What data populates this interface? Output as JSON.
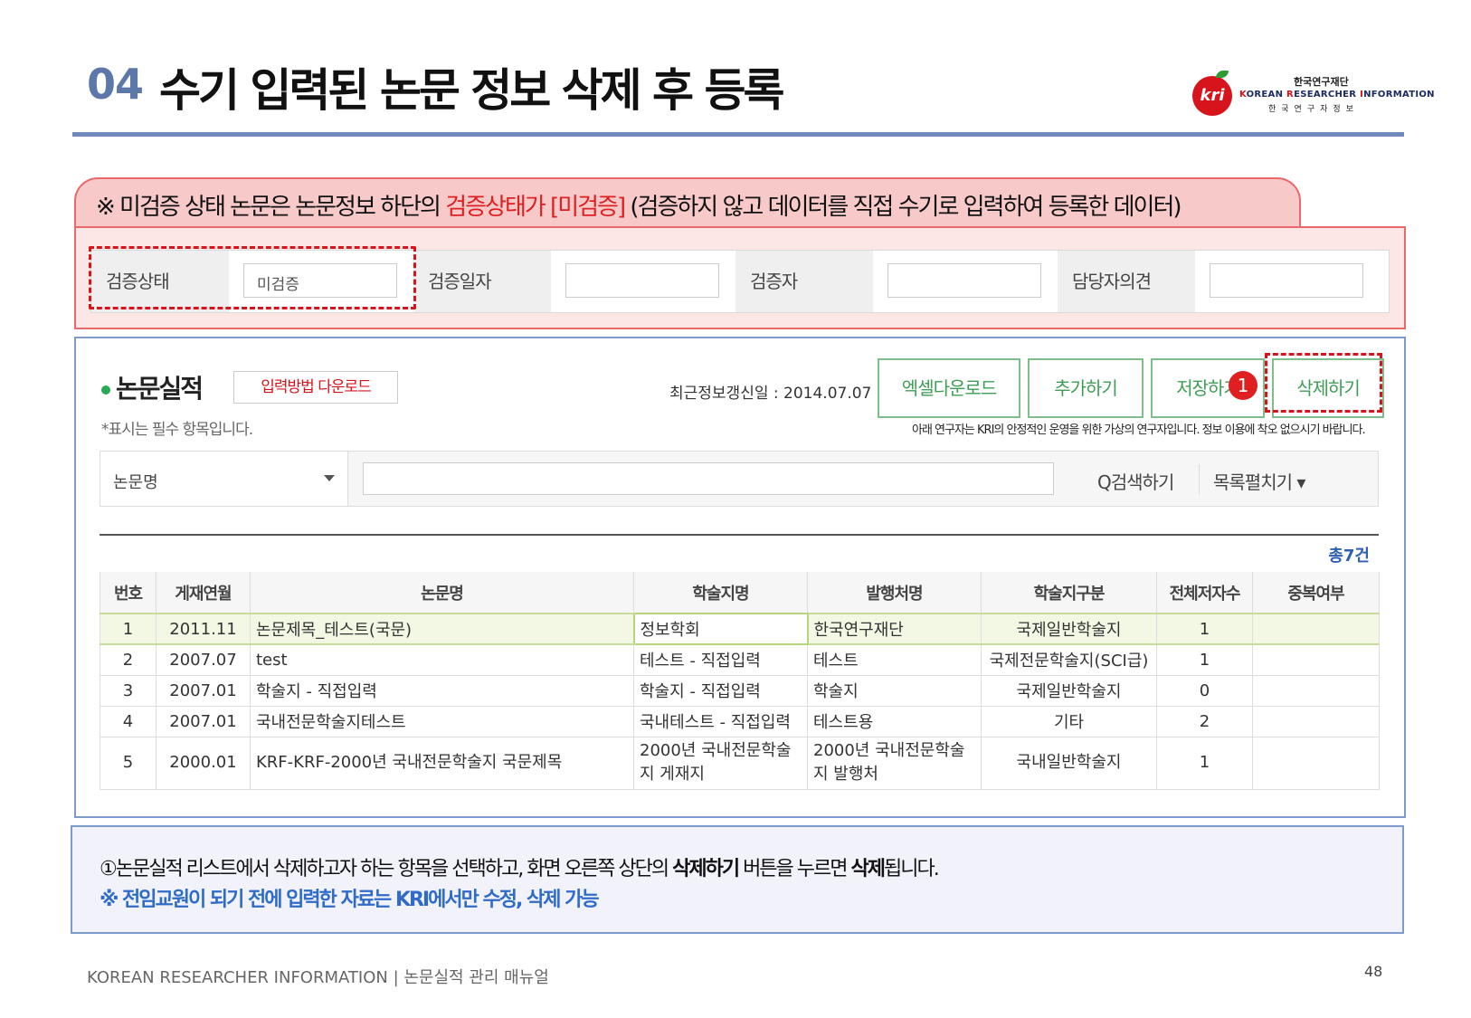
{
  "header": {
    "num": "04",
    "title": "수기 입력된 논문 정보 삭제 후 등록",
    "logo": {
      "mark": "kri",
      "kr_top": "한국연구재단",
      "en_parts": [
        "K",
        "OREAN ",
        "R",
        "ESEARCHER ",
        "I",
        "NFORMATION"
      ],
      "kr_bottom": "한국연구자정보"
    }
  },
  "notice": {
    "pre": "※ 미검증 상태 논문은 논문정보 하단의 ",
    "highlight": "검증상태가 [미검증]",
    "post": " (검증하지 않고 데이터를 직접 수기로 입력하여 등록한 데이터)"
  },
  "status_row": [
    {
      "label": "검증상태",
      "value": "미검증"
    },
    {
      "label": "검증일자",
      "value": ""
    },
    {
      "label": "검증자",
      "value": ""
    },
    {
      "label": "담당자의견",
      "value": ""
    }
  ],
  "panel": {
    "section_title": "논문실적",
    "download_label": "입력방법 다운로드",
    "required_note": "*표시는 필수 항목입니다.",
    "update_label": "최근정보갱신일 :",
    "update_date": "2014.07.07",
    "buttons": {
      "excel": "엑셀다운로드",
      "add": "추가하기",
      "save": "저장하기",
      "delete": "삭제하기"
    },
    "badge": "1",
    "virtual_note": "아래 연구자는 KRI의 안정적인 운영을 위한 가상의 연구자입니다. 정보 이용에 착오 없으시기 바랍니다.",
    "search": {
      "select_value": "논문명",
      "search_label": "Q검색하기",
      "expand_label": "목록펼치기 ▾"
    },
    "total": "총7건",
    "columns": [
      "번호",
      "게재연월",
      "논문명",
      "학술지명",
      "발행처명",
      "학술지구분",
      "전체저자수",
      "중복여부"
    ],
    "rows": [
      {
        "no": "1",
        "date": "2011.11",
        "title": "논문제목_테스트(국문)",
        "journal": "정보학회",
        "publisher": "한국연구재단",
        "type": "국제일반학술지",
        "authors": "1",
        "dup": ""
      },
      {
        "no": "2",
        "date": "2007.07",
        "title": "test",
        "journal": "테스트 - 직접입력",
        "publisher": "테스트",
        "type": "국제전문학술지(SCI급)",
        "authors": "1",
        "dup": ""
      },
      {
        "no": "3",
        "date": "2007.01",
        "title": "학술지 - 직접입력",
        "journal": "학술지 - 직접입력",
        "publisher": "학술지",
        "type": "국제일반학술지",
        "authors": "0",
        "dup": ""
      },
      {
        "no": "4",
        "date": "2007.01",
        "title": "국내전문학술지테스트",
        "journal": "국내테스트 - 직접입력",
        "publisher": "테스트용",
        "type": "기타",
        "authors": "2",
        "dup": ""
      },
      {
        "no": "5",
        "date": "2000.01",
        "title": "KRF-KRF-2000년 국내전문학술지 국문제목",
        "journal": "2000년 국내전문학술지 게재지",
        "publisher": "2000년 국내전문학술지 발행처",
        "type": "국내일반학술지",
        "authors": "1",
        "dup": ""
      }
    ]
  },
  "explanation": {
    "line1_pre": "①논문실적 리스트에서 삭제하고자 하는 항목을 선택하고, 화면 오른쪽 상단의 ",
    "line1_bold1": "삭제하기",
    "line1_mid": " 버튼을 누르면 ",
    "line1_bold2": "삭제",
    "line1_post": "됩니다.",
    "line2": "※ 전임교원이 되기 전에 입력한 자료는 KRI에서만 수정, 삭제 가능"
  },
  "footer": {
    "text": "KOREAN RESEARCHER INFORMATION  |  논문실적 관리 매뉴얼",
    "page": "48"
  },
  "colors": {
    "accent_blue": "#5b78a8",
    "notice_red": "#e02020",
    "button_green": "#3f9e55",
    "link_blue": "#2f6cc9"
  }
}
